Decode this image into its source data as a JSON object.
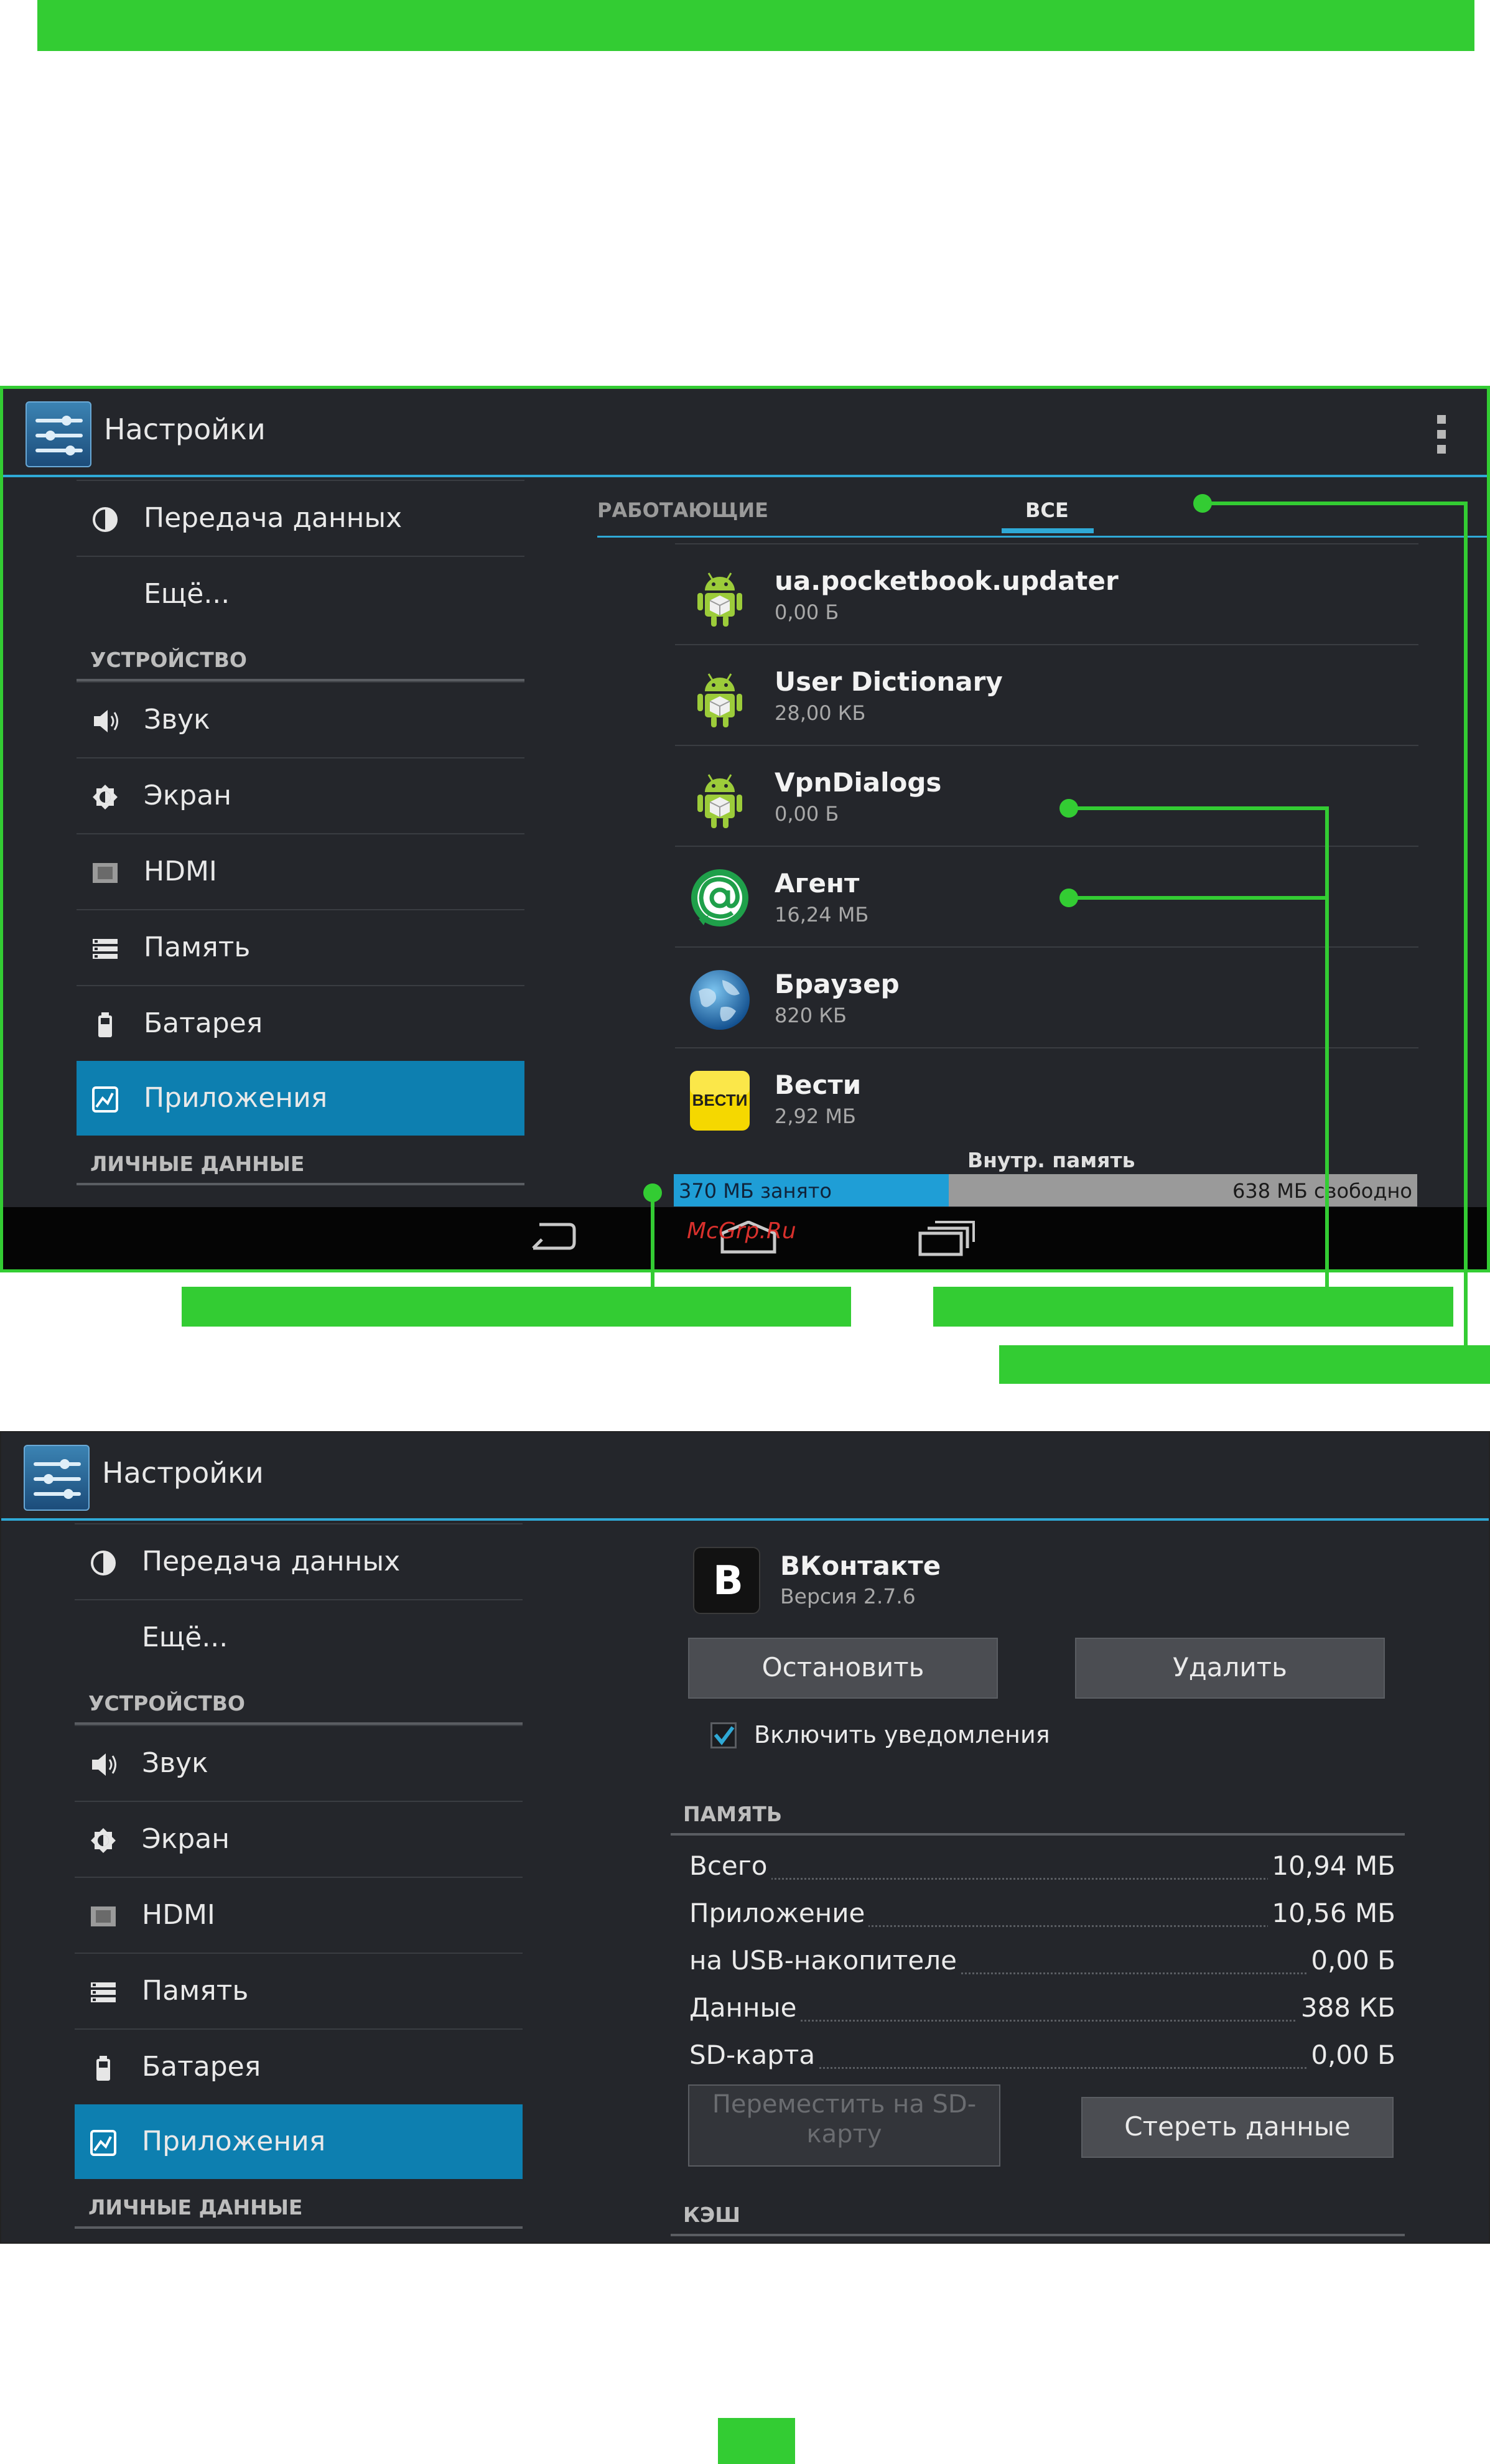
{
  "watermark": "McGrp.Ru",
  "screen1": {
    "title": "Настройки",
    "sidebar": [
      {
        "type": "item",
        "label": "Передача данных",
        "icon": "data-usage-icon"
      },
      {
        "type": "item",
        "label": "Ещё...",
        "icon": ""
      },
      {
        "type": "header",
        "label": "УСТРОЙСТВО"
      },
      {
        "type": "item",
        "label": "Звук",
        "icon": "speaker-icon"
      },
      {
        "type": "item",
        "label": "Экран",
        "icon": "brightness-icon"
      },
      {
        "type": "item",
        "label": "HDMI",
        "icon": "hdmi-icon"
      },
      {
        "type": "item",
        "label": "Память",
        "icon": "storage-icon"
      },
      {
        "type": "item",
        "label": "Батарея",
        "icon": "battery-icon"
      },
      {
        "type": "item",
        "label": "Приложения",
        "icon": "apps-icon",
        "active": true
      },
      {
        "type": "header",
        "label": "ЛИЧНЫЕ ДАННЫЕ"
      }
    ],
    "tabs": {
      "running": "РАБОТАЮЩИЕ",
      "all": "ВСЕ"
    },
    "apps": [
      {
        "name": "ua.pocketbook.updater",
        "size": "0,00 Б",
        "icon": "android-icon"
      },
      {
        "name": "User Dictionary",
        "size": "28,00 КБ",
        "icon": "android-icon"
      },
      {
        "name": "VpnDialogs",
        "size": "0,00 Б",
        "icon": "android-icon"
      },
      {
        "name": "Агент",
        "size": "16,24 МБ",
        "icon": "agent-at-icon"
      },
      {
        "name": "Браузер",
        "size": "820 КБ",
        "icon": "globe-icon"
      },
      {
        "name": "Вести",
        "size": "2,92 МБ",
        "icon": "vesti-icon"
      }
    ],
    "storage": {
      "label": "Внутр. память",
      "used": "370 МБ занято",
      "free": "638 МБ свободно",
      "used_fraction": 0.37
    }
  },
  "screen2": {
    "title": "Настройки",
    "app": {
      "name": "ВКонтакте",
      "version": "Версия 2.7.6",
      "icon_letter": "B"
    },
    "buttons": {
      "stop": "Остановить",
      "uninstall": "Удалить",
      "move": "Переместить на SD-карту",
      "clear": "Стереть данные"
    },
    "notify_label": "Включить уведомления",
    "memory_header": "ПАМЯТЬ",
    "memory_rows": [
      {
        "k": "Всего",
        "v": "10,94 МБ"
      },
      {
        "k": "Приложение",
        "v": "10,56 МБ"
      },
      {
        "k": "на USB-накопителе",
        "v": "0,00 Б"
      },
      {
        "k": "Данные",
        "v": "388 КБ"
      },
      {
        "k": "SD-карта",
        "v": "0,00 Б"
      }
    ],
    "cache_header": "КЭШ"
  },
  "colors": {
    "accent": "#2fa9d6",
    "callout": "#33cc33",
    "active": "#0d7fb0"
  }
}
